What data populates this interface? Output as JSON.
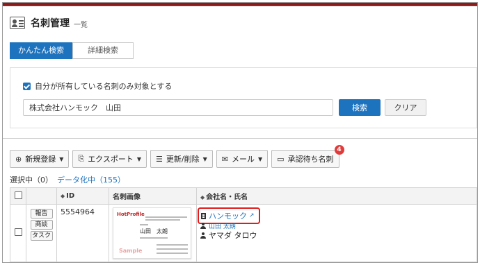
{
  "header": {
    "title": "名刺管理",
    "subtitle": "一覧",
    "icon": "business-card-icon"
  },
  "tabs": [
    {
      "label": "かんたん検索",
      "active": true
    },
    {
      "label": "詳細検索",
      "active": false
    }
  ],
  "search": {
    "checkbox_label": "自分が所有している名刺のみ対象とする",
    "checkbox_checked": true,
    "query_value": "株式会社ハンモック　山田",
    "search_button": "検索",
    "clear_button": "クリア"
  },
  "toolbar": {
    "new_label": "新規登録",
    "export_label": "エクスポート",
    "update_label": "更新/削除",
    "mail_label": "メール",
    "approve_label": "承認待ち名刺",
    "approve_count": "4"
  },
  "selection": {
    "selected_text": "選択中（0）",
    "data_link": "データ化中（155）"
  },
  "table": {
    "headers": {
      "id": "ID",
      "image": "名刺画像",
      "company_name": "会社名・氏名"
    },
    "rows": [
      {
        "actions": [
          "報告",
          "商談",
          "タスク"
        ],
        "id": "5554964",
        "card": {
          "logo": "HotProfile",
          "name": "山田　太朗",
          "watermark": "Sample"
        },
        "company": "ハンモック",
        "name_partial": "山田 太朗",
        "name_kana": "ヤマダ タロウ"
      }
    ]
  },
  "colors": {
    "accent": "#1e73be",
    "topbar": "#8e1a1a",
    "highlight": "#e21c1c",
    "badge": "#e03b3b"
  }
}
